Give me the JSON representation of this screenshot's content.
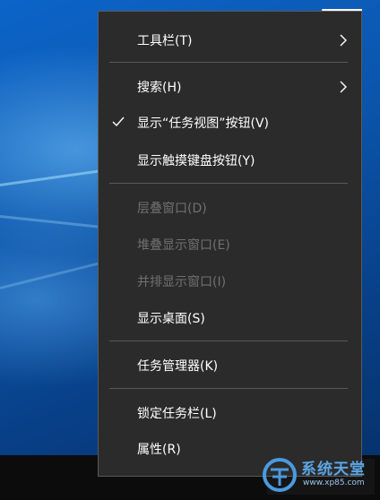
{
  "menu": {
    "items": [
      {
        "label": "工具栏(T)",
        "enabled": true,
        "checked": false,
        "submenu": true
      },
      {
        "label": "搜索(H)",
        "enabled": true,
        "checked": false,
        "submenu": true
      },
      {
        "label": "显示“任务视图”按钮(V)",
        "enabled": true,
        "checked": true,
        "submenu": false
      },
      {
        "label": "显示触摸键盘按钮(Y)",
        "enabled": true,
        "checked": false,
        "submenu": false
      },
      {
        "label": "层叠窗口(D)",
        "enabled": false,
        "checked": false,
        "submenu": false
      },
      {
        "label": "堆叠显示窗口(E)",
        "enabled": false,
        "checked": false,
        "submenu": false
      },
      {
        "label": "并排显示窗口(I)",
        "enabled": false,
        "checked": false,
        "submenu": false
      },
      {
        "label": "显示桌面(S)",
        "enabled": true,
        "checked": false,
        "submenu": false
      },
      {
        "label": "任务管理器(K)",
        "enabled": true,
        "checked": false,
        "submenu": false
      },
      {
        "label": "锁定任务栏(L)",
        "enabled": true,
        "checked": false,
        "submenu": false
      },
      {
        "label": "属性(R)",
        "enabled": true,
        "checked": false,
        "submenu": false
      }
    ]
  },
  "watermark": {
    "title": "系统天堂",
    "url": "www.xp85.com"
  },
  "colors": {
    "menu_bg": "#2b2b2b",
    "menu_text": "#ffffff",
    "menu_disabled_text": "#707070",
    "separator": "#5a5a5a",
    "watermark": "#5aa6e6"
  },
  "icons": {
    "check": "checkmark-icon",
    "submenu": "chevron-right-icon",
    "logo": "globe-logo-icon"
  }
}
